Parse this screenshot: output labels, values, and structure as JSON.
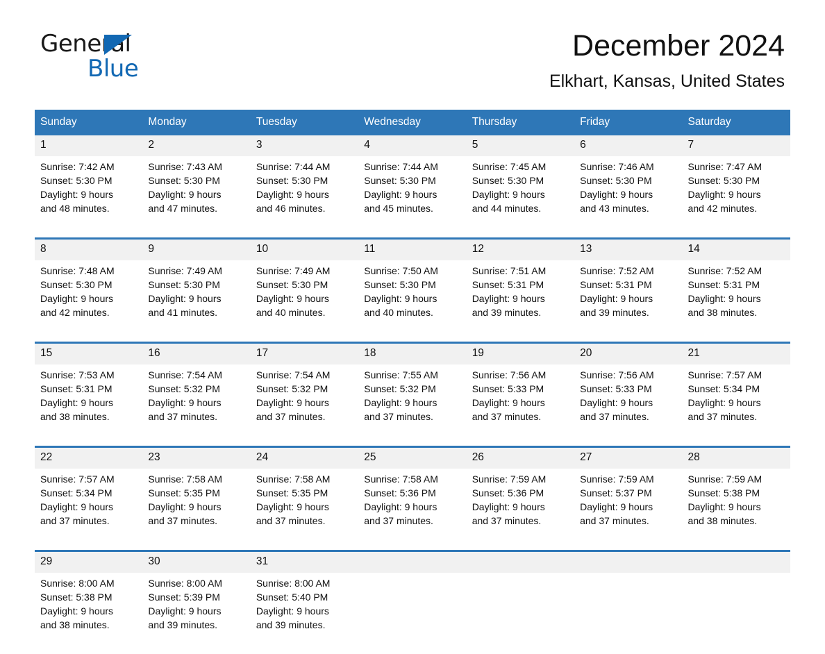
{
  "brand": {
    "name_part1": "General",
    "name_part2": "Blue",
    "logo_color": "#1268b3",
    "triangle_icon": "triangle-icon"
  },
  "header": {
    "title": "December 2024",
    "subtitle": "Elkhart, Kansas, United States"
  },
  "theme": {
    "header_blue": "#2e77b7",
    "daynum_band": "#f1f1f1",
    "text": "#111111"
  },
  "weekdays": [
    "Sunday",
    "Monday",
    "Tuesday",
    "Wednesday",
    "Thursday",
    "Friday",
    "Saturday"
  ],
  "weeks": [
    {
      "days": [
        {
          "date": "1",
          "sunrise": "Sunrise: 7:42 AM",
          "sunset": "Sunset: 5:30 PM",
          "daylight1": "Daylight: 9 hours",
          "daylight2": "and 48 minutes."
        },
        {
          "date": "2",
          "sunrise": "Sunrise: 7:43 AM",
          "sunset": "Sunset: 5:30 PM",
          "daylight1": "Daylight: 9 hours",
          "daylight2": "and 47 minutes."
        },
        {
          "date": "3",
          "sunrise": "Sunrise: 7:44 AM",
          "sunset": "Sunset: 5:30 PM",
          "daylight1": "Daylight: 9 hours",
          "daylight2": "and 46 minutes."
        },
        {
          "date": "4",
          "sunrise": "Sunrise: 7:44 AM",
          "sunset": "Sunset: 5:30 PM",
          "daylight1": "Daylight: 9 hours",
          "daylight2": "and 45 minutes."
        },
        {
          "date": "5",
          "sunrise": "Sunrise: 7:45 AM",
          "sunset": "Sunset: 5:30 PM",
          "daylight1": "Daylight: 9 hours",
          "daylight2": "and 44 minutes."
        },
        {
          "date": "6",
          "sunrise": "Sunrise: 7:46 AM",
          "sunset": "Sunset: 5:30 PM",
          "daylight1": "Daylight: 9 hours",
          "daylight2": "and 43 minutes."
        },
        {
          "date": "7",
          "sunrise": "Sunrise: 7:47 AM",
          "sunset": "Sunset: 5:30 PM",
          "daylight1": "Daylight: 9 hours",
          "daylight2": "and 42 minutes."
        }
      ]
    },
    {
      "days": [
        {
          "date": "8",
          "sunrise": "Sunrise: 7:48 AM",
          "sunset": "Sunset: 5:30 PM",
          "daylight1": "Daylight: 9 hours",
          "daylight2": "and 42 minutes."
        },
        {
          "date": "9",
          "sunrise": "Sunrise: 7:49 AM",
          "sunset": "Sunset: 5:30 PM",
          "daylight1": "Daylight: 9 hours",
          "daylight2": "and 41 minutes."
        },
        {
          "date": "10",
          "sunrise": "Sunrise: 7:49 AM",
          "sunset": "Sunset: 5:30 PM",
          "daylight1": "Daylight: 9 hours",
          "daylight2": "and 40 minutes."
        },
        {
          "date": "11",
          "sunrise": "Sunrise: 7:50 AM",
          "sunset": "Sunset: 5:30 PM",
          "daylight1": "Daylight: 9 hours",
          "daylight2": "and 40 minutes."
        },
        {
          "date": "12",
          "sunrise": "Sunrise: 7:51 AM",
          "sunset": "Sunset: 5:31 PM",
          "daylight1": "Daylight: 9 hours",
          "daylight2": "and 39 minutes."
        },
        {
          "date": "13",
          "sunrise": "Sunrise: 7:52 AM",
          "sunset": "Sunset: 5:31 PM",
          "daylight1": "Daylight: 9 hours",
          "daylight2": "and 39 minutes."
        },
        {
          "date": "14",
          "sunrise": "Sunrise: 7:52 AM",
          "sunset": "Sunset: 5:31 PM",
          "daylight1": "Daylight: 9 hours",
          "daylight2": "and 38 minutes."
        }
      ]
    },
    {
      "days": [
        {
          "date": "15",
          "sunrise": "Sunrise: 7:53 AM",
          "sunset": "Sunset: 5:31 PM",
          "daylight1": "Daylight: 9 hours",
          "daylight2": "and 38 minutes."
        },
        {
          "date": "16",
          "sunrise": "Sunrise: 7:54 AM",
          "sunset": "Sunset: 5:32 PM",
          "daylight1": "Daylight: 9 hours",
          "daylight2": "and 37 minutes."
        },
        {
          "date": "17",
          "sunrise": "Sunrise: 7:54 AM",
          "sunset": "Sunset: 5:32 PM",
          "daylight1": "Daylight: 9 hours",
          "daylight2": "and 37 minutes."
        },
        {
          "date": "18",
          "sunrise": "Sunrise: 7:55 AM",
          "sunset": "Sunset: 5:32 PM",
          "daylight1": "Daylight: 9 hours",
          "daylight2": "and 37 minutes."
        },
        {
          "date": "19",
          "sunrise": "Sunrise: 7:56 AM",
          "sunset": "Sunset: 5:33 PM",
          "daylight1": "Daylight: 9 hours",
          "daylight2": "and 37 minutes."
        },
        {
          "date": "20",
          "sunrise": "Sunrise: 7:56 AM",
          "sunset": "Sunset: 5:33 PM",
          "daylight1": "Daylight: 9 hours",
          "daylight2": "and 37 minutes."
        },
        {
          "date": "21",
          "sunrise": "Sunrise: 7:57 AM",
          "sunset": "Sunset: 5:34 PM",
          "daylight1": "Daylight: 9 hours",
          "daylight2": "and 37 minutes."
        }
      ]
    },
    {
      "days": [
        {
          "date": "22",
          "sunrise": "Sunrise: 7:57 AM",
          "sunset": "Sunset: 5:34 PM",
          "daylight1": "Daylight: 9 hours",
          "daylight2": "and 37 minutes."
        },
        {
          "date": "23",
          "sunrise": "Sunrise: 7:58 AM",
          "sunset": "Sunset: 5:35 PM",
          "daylight1": "Daylight: 9 hours",
          "daylight2": "and 37 minutes."
        },
        {
          "date": "24",
          "sunrise": "Sunrise: 7:58 AM",
          "sunset": "Sunset: 5:35 PM",
          "daylight1": "Daylight: 9 hours",
          "daylight2": "and 37 minutes."
        },
        {
          "date": "25",
          "sunrise": "Sunrise: 7:58 AM",
          "sunset": "Sunset: 5:36 PM",
          "daylight1": "Daylight: 9 hours",
          "daylight2": "and 37 minutes."
        },
        {
          "date": "26",
          "sunrise": "Sunrise: 7:59 AM",
          "sunset": "Sunset: 5:36 PM",
          "daylight1": "Daylight: 9 hours",
          "daylight2": "and 37 minutes."
        },
        {
          "date": "27",
          "sunrise": "Sunrise: 7:59 AM",
          "sunset": "Sunset: 5:37 PM",
          "daylight1": "Daylight: 9 hours",
          "daylight2": "and 37 minutes."
        },
        {
          "date": "28",
          "sunrise": "Sunrise: 7:59 AM",
          "sunset": "Sunset: 5:38 PM",
          "daylight1": "Daylight: 9 hours",
          "daylight2": "and 38 minutes."
        }
      ]
    },
    {
      "days": [
        {
          "date": "29",
          "sunrise": "Sunrise: 8:00 AM",
          "sunset": "Sunset: 5:38 PM",
          "daylight1": "Daylight: 9 hours",
          "daylight2": "and 38 minutes."
        },
        {
          "date": "30",
          "sunrise": "Sunrise: 8:00 AM",
          "sunset": "Sunset: 5:39 PM",
          "daylight1": "Daylight: 9 hours",
          "daylight2": "and 39 minutes."
        },
        {
          "date": "31",
          "sunrise": "Sunrise: 8:00 AM",
          "sunset": "Sunset: 5:40 PM",
          "daylight1": "Daylight: 9 hours",
          "daylight2": "and 39 minutes."
        },
        {
          "date": "",
          "sunrise": "",
          "sunset": "",
          "daylight1": "",
          "daylight2": ""
        },
        {
          "date": "",
          "sunrise": "",
          "sunset": "",
          "daylight1": "",
          "daylight2": ""
        },
        {
          "date": "",
          "sunrise": "",
          "sunset": "",
          "daylight1": "",
          "daylight2": ""
        },
        {
          "date": "",
          "sunrise": "",
          "sunset": "",
          "daylight1": "",
          "daylight2": ""
        }
      ]
    }
  ]
}
